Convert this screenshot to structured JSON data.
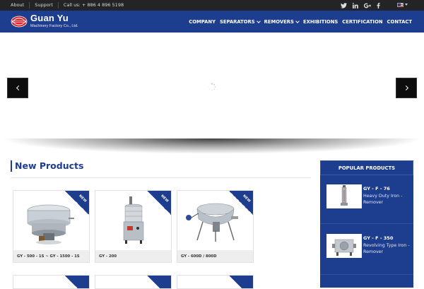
{
  "topbar": {
    "links": [
      "About",
      "Support",
      "Call us: + 886 4 896 5198"
    ],
    "social_icons": [
      "twitter-icon",
      "linkedin-icon",
      "google-plus-icon",
      "facebook-icon"
    ],
    "language_flag": "us-flag-icon"
  },
  "header": {
    "brand_name": "Guan Yu",
    "brand_subtitle": "Machinery Factory Co., Ltd.",
    "nav": [
      {
        "label": "COMPANY",
        "dropdown": false
      },
      {
        "label": "SEPARATORS",
        "dropdown": true
      },
      {
        "label": "REMOVERS",
        "dropdown": true
      },
      {
        "label": "EXHIBITIONS",
        "dropdown": false
      },
      {
        "label": "CERTIFICATION",
        "dropdown": false
      },
      {
        "label": "CONTACT",
        "dropdown": false
      }
    ]
  },
  "slider": {
    "prev_icon": "chevron-left-icon",
    "next_icon": "chevron-right-icon",
    "loading_icon": "spinner-icon"
  },
  "new_products": {
    "title": "New Products",
    "badge": "NEW",
    "items": [
      {
        "caption": "GY - 500 - 1S ~ GY - 1500 - 1S"
      },
      {
        "caption": "GY - 200"
      },
      {
        "caption": "GY - 600D / 800D"
      }
    ]
  },
  "popular_products": {
    "title": "POPULAR PRODUCTS",
    "items": [
      {
        "code": "GY - F - 76",
        "desc": "Heavy Duty Iron - Remover"
      },
      {
        "code": "GY - F - 350",
        "desc": "Revolving Type Iron - Remover"
      }
    ]
  },
  "colors": {
    "brand_blue": "#1d3e8e",
    "topbar_bg": "#222426",
    "caption_bg": "#eeeeee"
  }
}
